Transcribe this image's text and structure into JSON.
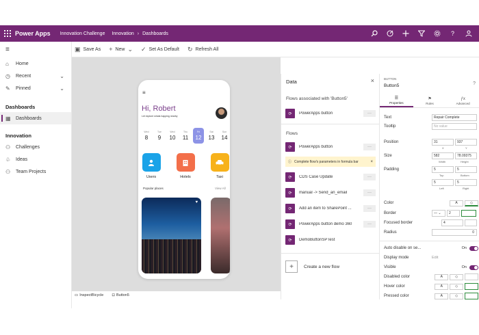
{
  "header": {
    "app_name": "Power Apps",
    "environment": "Innovation Challenge",
    "breadcrumb": [
      "Innovation",
      "Dashboards"
    ]
  },
  "commands": {
    "save_as": "Save As",
    "new": "New",
    "set_default": "Set As Default",
    "refresh": "Refresh All"
  },
  "nav": {
    "items_top": [
      "Home",
      "Recent",
      "Pinned"
    ],
    "section_dashboards": "Dashboards",
    "dashboards_item": "Dashboards",
    "section_innovation": "Innovation",
    "innovation_items": [
      "Challenges",
      "Ideas",
      "Team Projects"
    ]
  },
  "phone": {
    "greeting": "Hi, Robert",
    "subtitle": "Let explore whats happing nearby",
    "days": [
      {
        "name": "Wed",
        "num": "8"
      },
      {
        "name": "Tue",
        "num": "9"
      },
      {
        "name": "Wed",
        "num": "10"
      },
      {
        "name": "Thu",
        "num": "11"
      },
      {
        "name": "Fri",
        "num": "12"
      },
      {
        "name": "Sat",
        "num": "13"
      },
      {
        "name": "Sun",
        "num": "14"
      }
    ],
    "categories": [
      "Users",
      "Hotels",
      "Taxi"
    ],
    "popular": "Popular places",
    "view_all": "View All",
    "colors": {
      "users": "#1aa3e8",
      "hotels": "#f36f4a",
      "taxi": "#f7b21b",
      "selected_day": "#8d93e6"
    }
  },
  "statusbar": {
    "screen": "InspectBicycle",
    "control": "Button5"
  },
  "data_pane": {
    "title": "Data",
    "associated_heading": "Flows associated with 'Button5'",
    "associated_flow": "PowerApps button",
    "flows_heading": "Flows",
    "flows": [
      "PowerApps button",
      "CDS Case Update",
      "manual -> Send_an_email",
      "Add an item to SharePoint ...",
      "PowerApps button demo 360",
      "DemoButtonSPTest"
    ],
    "warning": "Complete flow's parameters in formula bar",
    "new_flow": "Create a new flow",
    "more": "···"
  },
  "props": {
    "type": "BUTTON",
    "name": "Button5",
    "tabs": [
      "Properties",
      "Rules",
      "Advanced"
    ],
    "text_label": "Text",
    "text_value": "Repair Complete",
    "tooltip_label": "Tooltip",
    "tooltip_placeholder": "No value",
    "position_label": "Position",
    "x": "31",
    "y": "937",
    "x_lbl": "X",
    "y_lbl": "Y",
    "size_label": "Size",
    "width": "582",
    "height": "78.09375",
    "w_lbl": "Width",
    "h_lbl": "Height",
    "padding_label": "Padding",
    "pad_top": "5",
    "pad_bottom": "5",
    "pad_left": "5",
    "pad_right": "5",
    "top_lbl": "Top",
    "bottom_lbl": "Bottom",
    "left_lbl": "Left",
    "right_lbl": "Right",
    "color_label": "Color",
    "border_label": "Border",
    "border_width": "2",
    "focused_border_label": "Focused border",
    "focused_border_value": "4",
    "radius_label": "Radius",
    "radius_value": "0",
    "auto_disable_label": "Auto disable on se...",
    "auto_disable_value": "On",
    "display_mode_label": "Display mode",
    "display_mode_value": "Edit",
    "visible_label": "Visible",
    "visible_value": "On",
    "disabled_color_label": "Disabled color",
    "hover_color_label": "Hover color",
    "pressed_color_label": "Pressed color",
    "a_glyph": "A"
  }
}
